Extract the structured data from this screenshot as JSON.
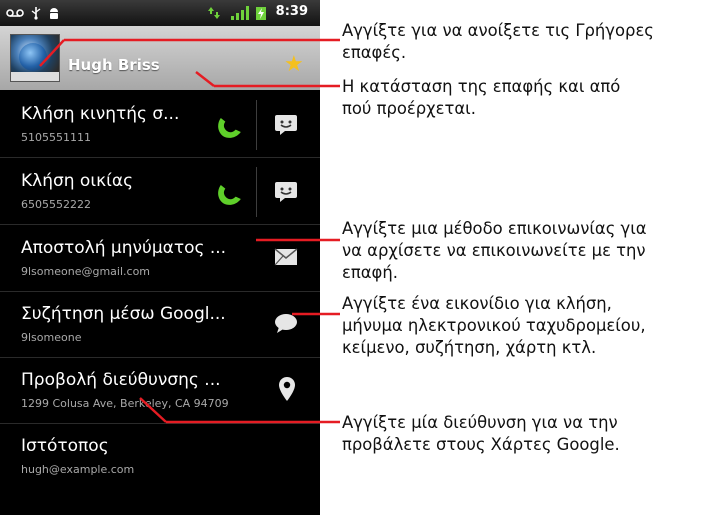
{
  "status_bar": {
    "time": "8:39"
  },
  "contact": {
    "name": "Hugh Briss",
    "starred": true
  },
  "rows": [
    {
      "title": "Κλήση κινητής σ...",
      "subtitle": "5105551111",
      "icon": "phone-icon",
      "secondary_icon": "sms-icon"
    },
    {
      "title": "Κλήση οικίας",
      "subtitle": "6505552222",
      "icon": "phone-icon",
      "secondary_icon": "sms-icon"
    },
    {
      "title": "Αποστολή μηνύματος ...",
      "subtitle": "9lsomeone@gmail.com",
      "icon": "envelope-icon"
    },
    {
      "title": "Συζήτηση μέσω Googl...",
      "subtitle": "9lsomeone",
      "icon": "chat-bubble-icon"
    },
    {
      "title": "Προβολή διεύθυνσης ...",
      "subtitle": "1299 Colusa Ave, Berkeley, CA 94709",
      "icon": "map-pin-icon"
    },
    {
      "title": "Ιστότοπος",
      "subtitle": "hugh@example.com"
    }
  ],
  "callouts": [
    {
      "lines": [
        "Αγγίξτε για να ανοίξετε τις Γρήγορες",
        "επαφές."
      ]
    },
    {
      "lines": [
        "Η κατάσταση της επαφής και από",
        "πού προέρχεται."
      ]
    },
    {
      "lines": [
        "Αγγίξτε μια μέθοδο επικοινωνίας για",
        "να αρχίσετε να επικοινωνείτε με την",
        "επαφή."
      ]
    },
    {
      "lines": [
        "Αγγίξτε ένα εικονίδιο για κλήση,",
        "μήνυμα ηλεκτρονικού ταχυδρομείου,",
        "κείμενο, συζήτηση, χάρτη κτλ."
      ]
    },
    {
      "lines": [
        "Αγγίξτε μία διεύθυνση για να την",
        "προβάλετε στους Χάρτες Google."
      ]
    }
  ],
  "colors": {
    "callout_line": "#e51c23",
    "phone_icon": "#5fcf2a",
    "star": "#f4c01e",
    "screen_bg": "#000000"
  }
}
